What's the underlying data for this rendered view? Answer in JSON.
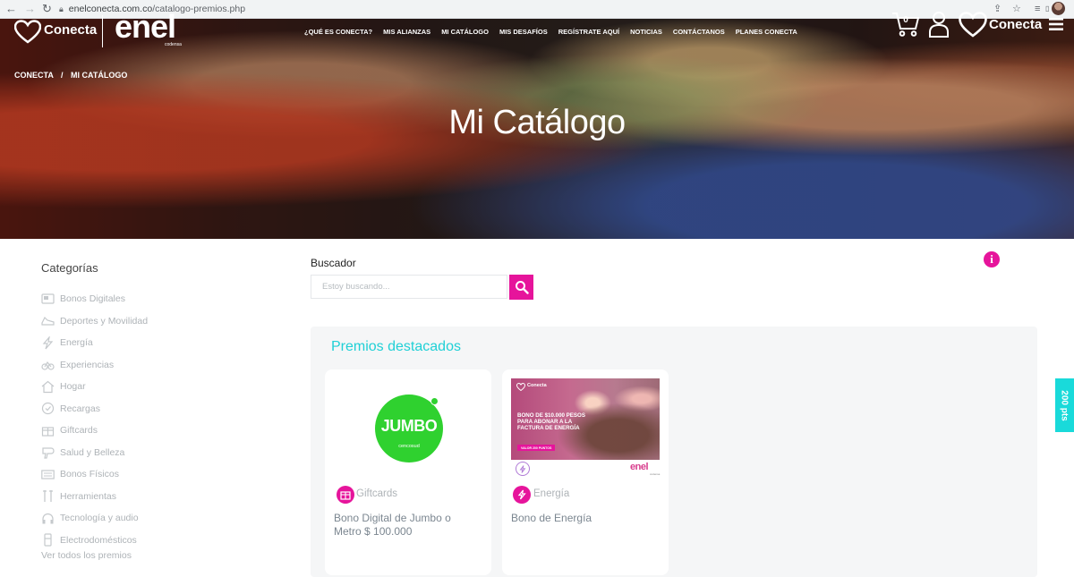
{
  "browser": {
    "url_domain": "enelconecta.com.co",
    "url_path": "/catalogo-premios.php"
  },
  "header": {
    "logo_text": "Conecta",
    "brand_text": "enel",
    "brand_sub": "codensa",
    "nav": [
      "¿QUÉ ES CONECTA?",
      "MIS ALIANZAS",
      "MI CATÁLOGO",
      "MIS DESAFÍOS",
      "REGÍSTRATE AQUÍ",
      "NOTICIAS",
      "CONTÁCTANOS",
      "PLANES CONECTA"
    ],
    "cart_count": "0",
    "right_logo_text": "Conecta"
  },
  "breadcrumb": {
    "root": "CONECTA",
    "separator": "/",
    "current": "MI CATÁLOGO"
  },
  "hero": {
    "title": "Mi Catálogo"
  },
  "sidebar": {
    "title": "Categorías",
    "items": [
      "Bonos Digitales",
      "Deportes y Movilidad",
      "Energía",
      "Experiencias",
      "Hogar",
      "Recargas",
      "Giftcards",
      "Salud y Belleza",
      "Bonos Físicos",
      "Herramientas",
      "Tecnología y audio",
      "Electrodomésticos"
    ],
    "see_all": "Ver todos los premios"
  },
  "search": {
    "label": "Buscador",
    "placeholder": "Estoy buscando..."
  },
  "featured": {
    "title": "Premios destacados",
    "cards": [
      {
        "logo_text": "JUMBO",
        "logo_sub": "cencosud",
        "category": "Giftcards",
        "title": "Bono Digital de Jumbo o Metro $ 100.000"
      },
      {
        "banner_brand": "Conecta",
        "banner_text": "BONO DE $10.000 PESOS PARA ABONAR A LA FACTURA DE ENERGÍA",
        "banner_pill": "VALOR 200 PUNTOS",
        "brand_logo": "enel",
        "brand_sub": "codensa",
        "category": "Energía",
        "title": "Bono de Energía"
      }
    ]
  },
  "points_tab": {
    "label": "200 pts"
  },
  "colors": {
    "accent_magenta": "#e6149b",
    "accent_cyan": "#20d0d6",
    "muted_text": "#aeb3b7"
  }
}
